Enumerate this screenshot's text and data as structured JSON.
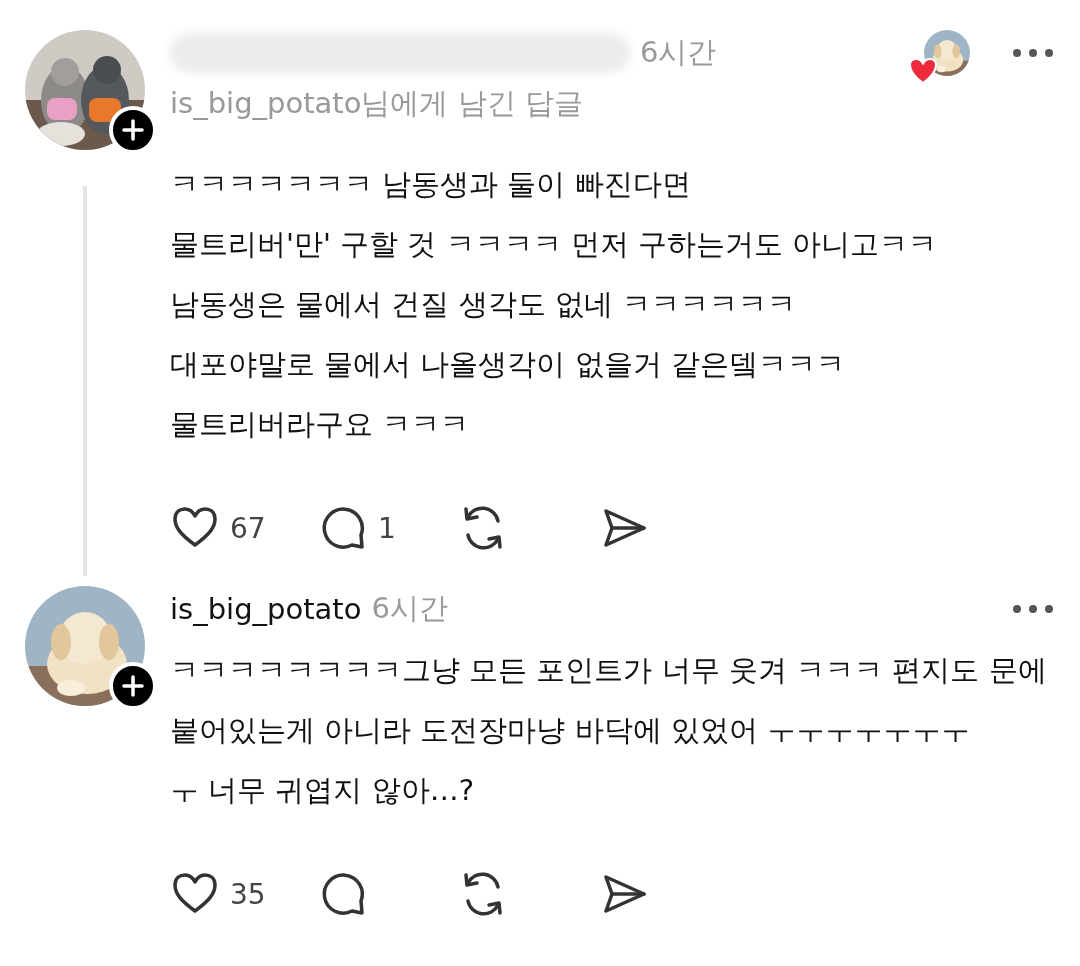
{
  "comments": [
    {
      "avatar": {
        "kind": "picture"
      },
      "username_redacted": true,
      "time": "6시간",
      "reply_to": "is_big_potato님에게 남긴 답글",
      "liked_by_author": true,
      "thread_line": true,
      "lines": [
        "ㅋㅋㅋㅋㅋㅋㅋ 남동생과 둘이 빠진다면",
        "물트리버'만' 구할 것 ㅋㅋㅋㅋ 먼저 구하는거도 아니고ㅋㅋ",
        "남동생은 물에서 건질 생각도 없네 ㅋㅋㅋㅋㅋㅋ",
        "대포야말로 물에서 나올생각이 없을거 같은뎈ㅋㅋㅋ",
        "물트리버라구요 ㅋㅋㅋ"
      ],
      "actions": [
        {
          "kind": "like",
          "count": "67"
        },
        {
          "kind": "reply",
          "count": "1"
        },
        {
          "kind": "repost"
        },
        {
          "kind": "share"
        }
      ]
    },
    {
      "avatar": {
        "kind": "picture"
      },
      "username_redacted": false,
      "username": "is_big_potato",
      "time": "6시간",
      "liked_by_author": false,
      "thread_line": false,
      "lines": [
        "ㅋㅋㅋㅋㅋㅋㅋㅋ그냥 모든 포인트가 너무 웃겨 ㅋㅋㅋ 편지도 문에",
        "붙어있는게 아니라 도전장마냥 바닥에 있었어 ㅜㅜㅜㅜㅜㅜㅜ",
        "ㅜ 너무 귀엽지 않아…?"
      ],
      "actions": [
        {
          "kind": "like",
          "count": "35"
        },
        {
          "kind": "reply"
        },
        {
          "kind": "repost"
        },
        {
          "kind": "share"
        }
      ]
    }
  ]
}
